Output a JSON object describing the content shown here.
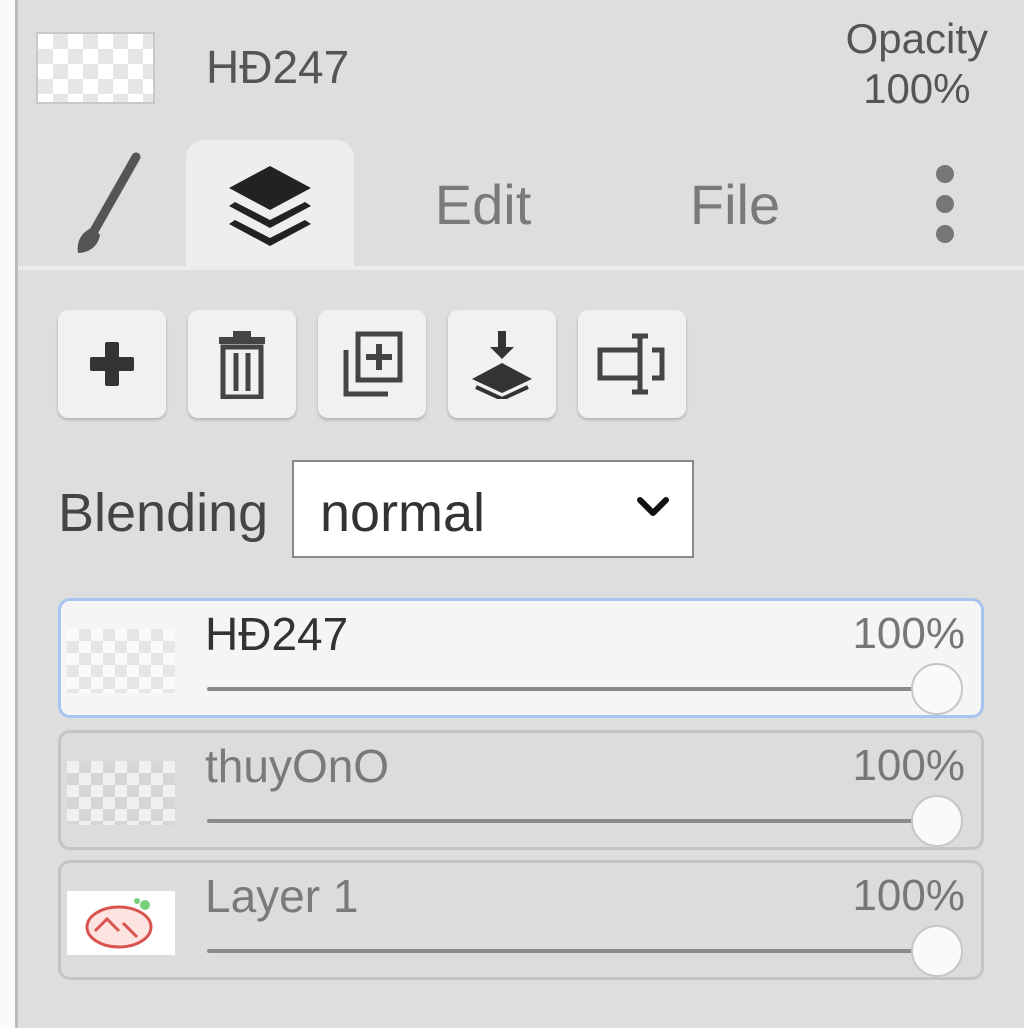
{
  "header": {
    "layer_name": "HĐ247",
    "opacity_label": "Opacity",
    "opacity_value": "100%"
  },
  "tabs": {
    "brush_icon": "brush-icon",
    "layers_icon": "layers-icon",
    "edit_label": "Edit",
    "file_label": "File",
    "more_icon": "more-vertical-icon"
  },
  "toolbar": {
    "buttons": [
      "add-layer",
      "delete-layer",
      "duplicate-layer",
      "merge-down",
      "rename-layer"
    ]
  },
  "blending": {
    "label": "Blending",
    "value": "normal"
  },
  "layers": [
    {
      "name": "HĐ247",
      "opacity": "100%",
      "selected": true
    },
    {
      "name": "thuyOnO",
      "opacity": "100%",
      "selected": false
    },
    {
      "name": "Layer 1",
      "opacity": "100%",
      "selected": false
    }
  ],
  "colors": {
    "panel_bg": "#dedede",
    "selected_border": "#a8c4ee"
  }
}
